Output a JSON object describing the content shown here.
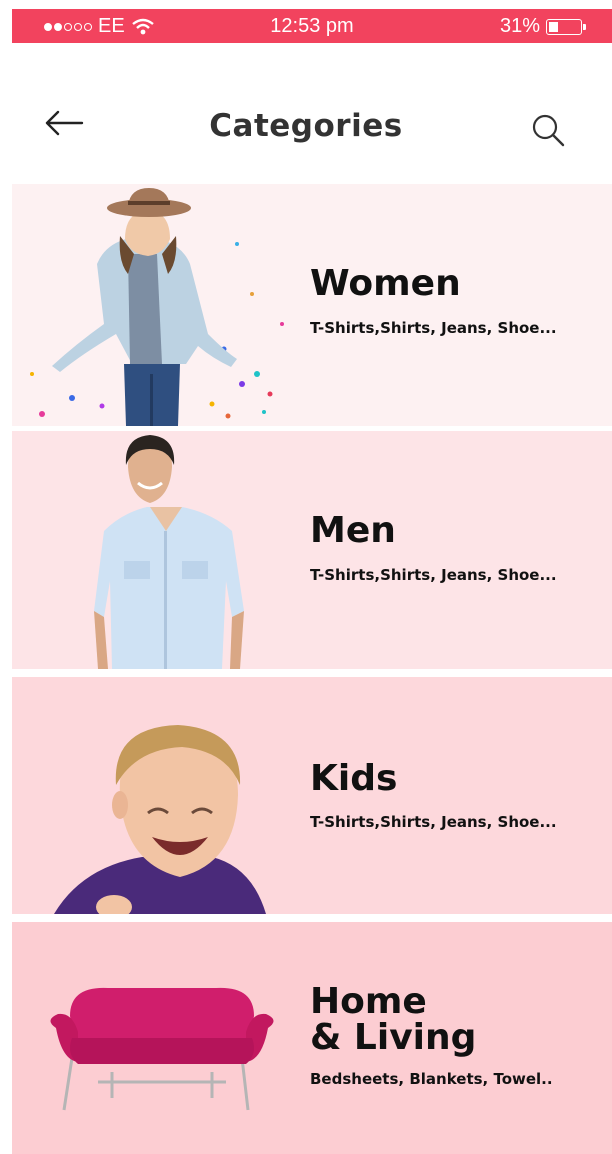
{
  "status_bar": {
    "carrier": "EE",
    "time": "12:53 pm",
    "battery": "31%",
    "battery_level": 0.31,
    "signal_icon": "signal-dots-icon",
    "wifi_icon": "wifi-icon"
  },
  "header": {
    "title": "Categories",
    "back_icon": "back-arrow-icon",
    "search_icon": "search-icon"
  },
  "categories": [
    {
      "label": "Women",
      "subtitle": "T-Shirts,Shirts, Jeans, Shoe...",
      "bg": "#fdf1f2",
      "image": "woman-in-hat-photo"
    },
    {
      "label": "Men",
      "subtitle": "T-Shirts,Shirts, Jeans, Shoe...",
      "bg": "#fde4e7",
      "image": "man-in-shirt-photo"
    },
    {
      "label": "Kids",
      "subtitle": "T-Shirts,Shirts, Jeans, Shoe...",
      "bg": "#fdd8dc",
      "image": "laughing-child-photo"
    },
    {
      "label": "Home\n& Living",
      "subtitle": "Bedsheets, Blankets, Towel..",
      "bg": "#fccdd2",
      "image": "pink-sofa-photo"
    }
  ],
  "colors": {
    "status_bar": "#f2435e",
    "title": "#333333"
  }
}
